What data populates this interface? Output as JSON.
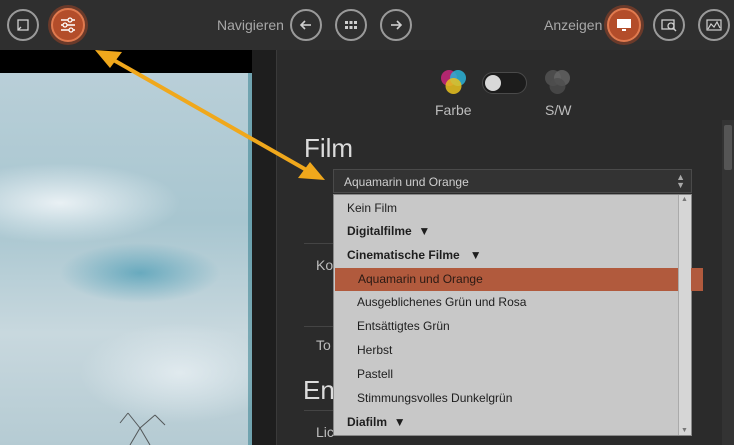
{
  "toolbar": {
    "navigate_label": "Navigieren",
    "view_label": "Anzeigen"
  },
  "color_toggle": {
    "color_label": "Farbe",
    "bw_label": "S/W"
  },
  "film_section": {
    "title": "Film",
    "selected_value": "Aquamarin und Orange",
    "options": [
      {
        "label": "Kein Film",
        "kind": "top"
      },
      {
        "label": "Digitalfilme",
        "kind": "group",
        "caret": "▼"
      },
      {
        "label": "Cinematische Filme",
        "kind": "group",
        "caret": "▼"
      },
      {
        "label": "Aquamarin und Orange",
        "kind": "item",
        "selected": true
      },
      {
        "label": "Ausgeblichenes Grün und Rosa",
        "kind": "item"
      },
      {
        "label": "Entsättigtes Grün",
        "kind": "item"
      },
      {
        "label": "Herbst",
        "kind": "item"
      },
      {
        "label": "Pastell",
        "kind": "item"
      },
      {
        "label": "Stimmungsvolles Dunkelgrün",
        "kind": "item"
      },
      {
        "label": "Diafilm",
        "kind": "group",
        "caret": "▼"
      }
    ],
    "side_labels": [
      "Ko",
      "To",
      "Lic"
    ]
  },
  "next_section": {
    "title_partial": "En"
  },
  "colors": {
    "accent": "#b34d2a",
    "selected_option": "#b15a3d",
    "annotation_arrow": "#f0a81c"
  }
}
